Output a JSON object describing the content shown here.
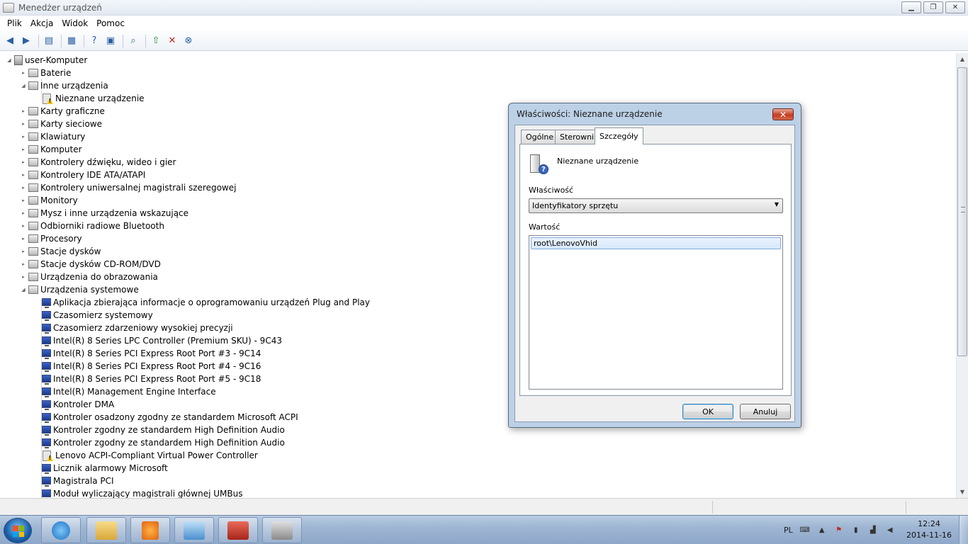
{
  "window": {
    "title": "Menedżer urządzeń",
    "controls": {
      "minimize": "▁",
      "restore": "❐",
      "close": "✕"
    }
  },
  "menu": [
    "Plik",
    "Akcja",
    "Widok",
    "Pomoc"
  ],
  "toolbar_icons": [
    "back-icon",
    "forward-icon",
    "show-hide-console-tree-icon",
    "properties-icon",
    "help-icon",
    "scan-hardware-icon",
    "update-driver-icon",
    "disable-icon",
    "uninstall-icon"
  ],
  "tree": {
    "root": "user-Komputer",
    "categories": [
      {
        "label": "Baterie",
        "expanded": false
      },
      {
        "label": "Inne urządzenia",
        "expanded": true,
        "children": [
          "Nieznane urządzenie"
        ]
      },
      {
        "label": "Karty graficzne",
        "expanded": false
      },
      {
        "label": "Karty sieciowe",
        "expanded": false
      },
      {
        "label": "Klawiatury",
        "expanded": false
      },
      {
        "label": "Komputer",
        "expanded": false
      },
      {
        "label": "Kontrolery dźwięku, wideo i gier",
        "expanded": false
      },
      {
        "label": "Kontrolery IDE ATA/ATAPI",
        "expanded": false
      },
      {
        "label": "Kontrolery uniwersalnej magistrali szeregowej",
        "expanded": false
      },
      {
        "label": "Monitory",
        "expanded": false
      },
      {
        "label": "Mysz i inne urządzenia wskazujące",
        "expanded": false
      },
      {
        "label": "Odbiorniki radiowe Bluetooth",
        "expanded": false
      },
      {
        "label": "Procesory",
        "expanded": false
      },
      {
        "label": "Stacje dysków",
        "expanded": false
      },
      {
        "label": "Stacje dysków CD-ROM/DVD",
        "expanded": false
      },
      {
        "label": "Urządzenia do obrazowania",
        "expanded": false
      },
      {
        "label": "Urządzenia systemowe",
        "expanded": true,
        "children": [
          "Aplikacja zbierająca informacje o oprogramowaniu urządzeń Plug and Play",
          "Czasomierz systemowy",
          "Czasomierz zdarzeniowy wysokiej precyzji",
          "Intel(R) 8 Series LPC Controller (Premium SKU) - 9C43",
          "Intel(R) 8 Series PCI Express Root Port #3 - 9C14",
          "Intel(R) 8 Series PCI Express Root Port #4 - 9C16",
          "Intel(R) 8 Series PCI Express Root Port #5 - 9C18",
          "Intel(R) Management Engine Interface",
          "Kontroler DMA",
          "Kontroler osadzony zgodny ze standardem Microsoft ACPI",
          "Kontroler zgodny ze standardem High Definition Audio",
          "Kontroler zgodny ze standardem High Definition Audio",
          "Lenovo ACPI-Compliant Virtual Power Controller",
          "Licznik alarmowy Microsoft",
          "Magistrala PCI",
          "Moduł wyliczający magistrali głównej UMBus"
        ]
      }
    ]
  },
  "dialog": {
    "title": "Właściwości: Nieznane urządzenie",
    "tabs": [
      "Ogólne",
      "Sterownik",
      "Szczegóły"
    ],
    "active_tab": "Szczegóły",
    "device_name": "Nieznane urządzenie",
    "property_label": "Właściwość",
    "property_value": "Identyfikatory sprzętu",
    "value_label": "Wartość",
    "values": [
      "root\\LenovoVhid"
    ],
    "ok": "OK",
    "cancel": "Anuluj"
  },
  "taskbar": {
    "lang": "PL",
    "time": "12:24",
    "date": "2014-11-16"
  }
}
